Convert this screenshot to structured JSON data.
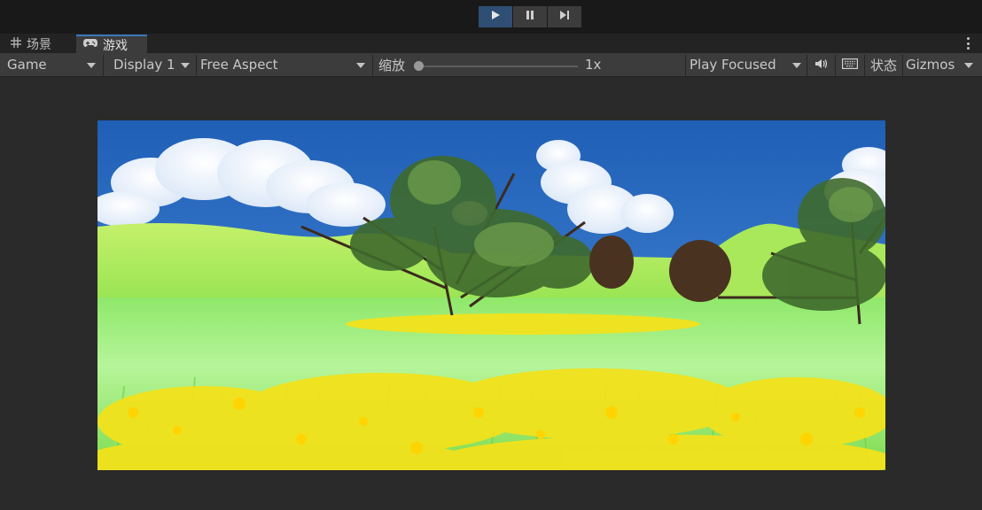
{
  "toolbar_top": {
    "play_icon": "play-icon",
    "pause_icon": "pause-icon",
    "step_icon": "step-icon"
  },
  "tabs": [
    {
      "label": "场景",
      "icon": "scene-grid-icon"
    },
    {
      "label": "游戏",
      "icon": "gamepad-icon"
    }
  ],
  "game_toolbar": {
    "view_mode": "Game",
    "display": "Display 1",
    "aspect": "Free Aspect",
    "scale_label": "缩放",
    "scale_value": "1x",
    "play_mode": "Play Focused",
    "audio_icon": "speaker-icon",
    "stats_icon": "keyboard-icon",
    "stats_label": "状态",
    "gizmos_label": "Gizmos"
  },
  "colors": {
    "accent": "#3a79bb",
    "play_active": "#2f4e74",
    "sky": "#2f6fc6",
    "grass": "#9ff25a",
    "flowers": "#f5e51e"
  }
}
